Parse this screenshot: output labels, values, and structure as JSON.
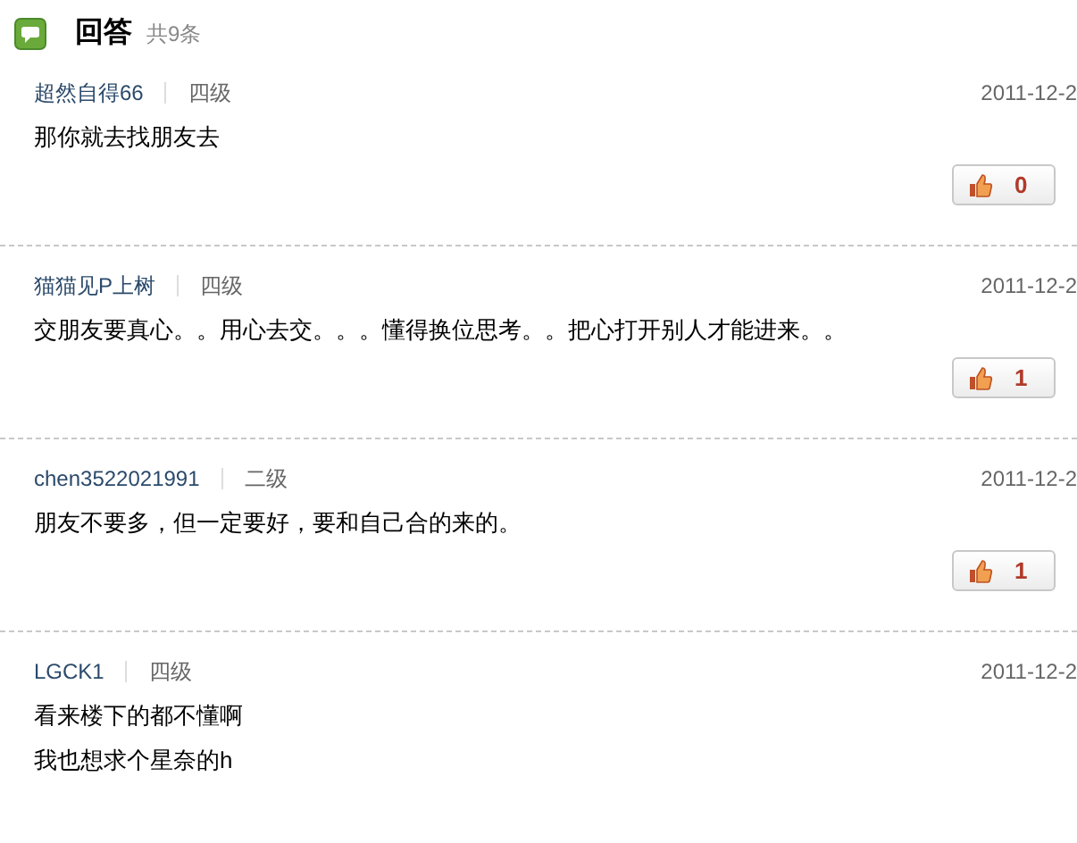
{
  "header": {
    "title": "回答",
    "count": "共9条"
  },
  "answers": [
    {
      "user": "超然自得66",
      "level": "四级",
      "date": "2011-12-2",
      "lines": [
        "那你就去找朋友去"
      ],
      "votes": "0"
    },
    {
      "user": "猫猫见P上树",
      "level": "四级",
      "date": "2011-12-2",
      "lines": [
        "交朋友要真心。。用心去交。。。懂得换位思考。。把心打开别人才能进来。。"
      ],
      "votes": "1"
    },
    {
      "user": "chen3522021991",
      "level": "二级",
      "date": "2011-12-2",
      "lines": [
        "朋友不要多，但一定要好，要和自己合的来的。"
      ],
      "votes": "1"
    },
    {
      "user": "LGCK1",
      "level": "四级",
      "date": "2011-12-2",
      "lines": [
        "看来楼下的都不懂啊",
        "我也想求个星奈的h"
      ]
    }
  ]
}
